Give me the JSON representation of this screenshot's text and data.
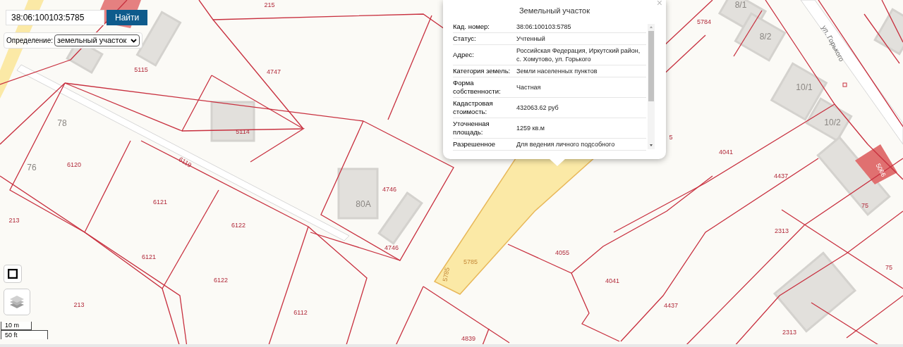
{
  "search": {
    "value": "38:06:100103:5785",
    "button": "Найти"
  },
  "definition": {
    "label": "Определение:",
    "value": "земельный участок"
  },
  "popup": {
    "title": "Земельный участок",
    "close": "×",
    "rows": [
      {
        "label": "Кад. номер:",
        "value": "38:06:100103:5785"
      },
      {
        "label": "Статус:",
        "value": "Учтенный"
      },
      {
        "label": "Адрес:",
        "value": "Российская Федерация, Иркутский район, с. Хомутово, ул. Горького"
      },
      {
        "label": "Категория земель:",
        "value": "Земли населенных пунктов"
      },
      {
        "label": "Форма собственности:",
        "value": "Частная"
      },
      {
        "label": "Кадастровая стоимость:",
        "value": "432063.62 руб"
      },
      {
        "label": "Уточненная площадь:",
        "value": "1259 кв.м"
      },
      {
        "label": "Разрешенное",
        "value": "Для ведения личного подсобного"
      }
    ]
  },
  "map": {
    "labels": [
      {
        "text": "215",
        "kind": "parcel"
      },
      {
        "text": "8/1",
        "kind": "house"
      },
      {
        "text": "5784",
        "kind": "parcel"
      },
      {
        "text": "8/2",
        "kind": "house"
      },
      {
        "text": "ул. Горького",
        "kind": "street"
      },
      {
        "text": "5115",
        "kind": "parcel"
      },
      {
        "text": "4747",
        "kind": "parcel"
      },
      {
        "text": "10/1",
        "kind": "house"
      },
      {
        "text": "10/2",
        "kind": "house"
      },
      {
        "text": "78",
        "kind": "house"
      },
      {
        "text": "5114",
        "kind": "parcel"
      },
      {
        "text": "5",
        "kind": "parcel"
      },
      {
        "text": "4041",
        "kind": "parcel"
      },
      {
        "text": "76",
        "kind": "house"
      },
      {
        "text": "6120",
        "kind": "parcel"
      },
      {
        "text": "6119",
        "kind": "parcel"
      },
      {
        "text": "5066",
        "kind": "marked"
      },
      {
        "text": "4437",
        "kind": "parcel"
      },
      {
        "text": "4746",
        "kind": "parcel"
      },
      {
        "text": "6121",
        "kind": "parcel"
      },
      {
        "text": "80А",
        "kind": "house"
      },
      {
        "text": "75",
        "kind": "parcel"
      },
      {
        "text": "213",
        "kind": "parcel"
      },
      {
        "text": "6122",
        "kind": "parcel"
      },
      {
        "text": "2313",
        "kind": "parcel"
      },
      {
        "text": "4746",
        "kind": "parcel"
      },
      {
        "text": "4055",
        "kind": "parcel"
      },
      {
        "text": "6121",
        "kind": "parcel"
      },
      {
        "text": "5785",
        "kind": "selected"
      },
      {
        "text": "75",
        "kind": "parcel"
      },
      {
        "text": "5785",
        "kind": "selected"
      },
      {
        "text": "6122",
        "kind": "parcel"
      },
      {
        "text": "4041",
        "kind": "parcel"
      },
      {
        "text": "213",
        "kind": "parcel"
      },
      {
        "text": "4437",
        "kind": "parcel"
      },
      {
        "text": "6112",
        "kind": "parcel"
      },
      {
        "text": "2313",
        "kind": "parcel"
      },
      {
        "text": "4839",
        "kind": "parcel"
      }
    ]
  },
  "scale": {
    "metric": "10 m",
    "imperial": "50 ft"
  }
}
